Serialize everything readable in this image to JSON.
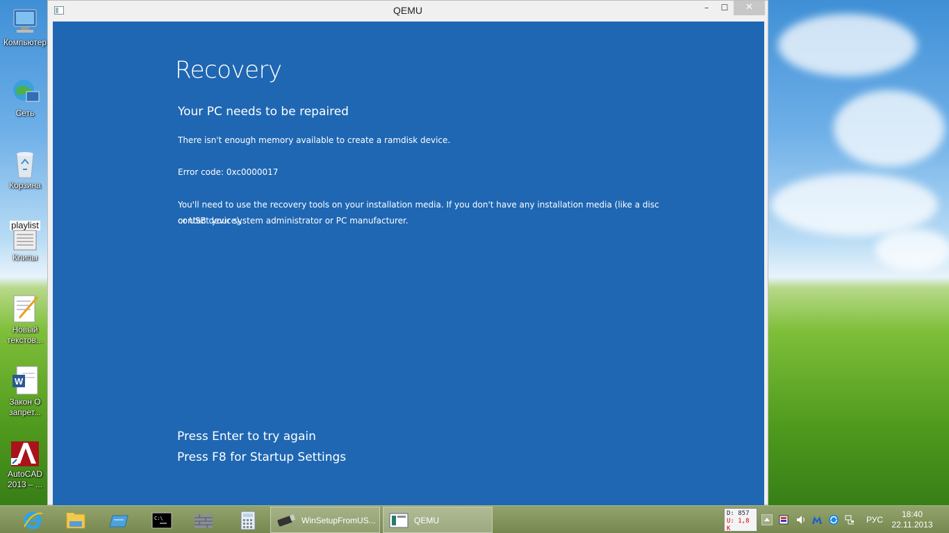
{
  "desktop": {
    "icons": [
      {
        "label": "Компьютер",
        "icon": "computer-icon"
      },
      {
        "label": "Сеть",
        "icon": "network-icon"
      },
      {
        "label": "Корзина",
        "icon": "recycle-bin-icon"
      },
      {
        "label": "Клипы",
        "icon": "playlist-icon",
        "overlay_text": "playlist"
      },
      {
        "label": "Новый текстов...",
        "icon": "text-document-icon"
      },
      {
        "label": "Закон О запрет...",
        "icon": "word-document-icon"
      },
      {
        "label": "AutoCAD 2013 – ...",
        "icon": "autocad-icon"
      }
    ]
  },
  "window": {
    "title": "QEMU",
    "controls": {
      "minimize": "–",
      "maximize": "☐",
      "close": "✕"
    }
  },
  "recovery": {
    "title": "Recovery",
    "subtitle": "Your PC needs to be repaired",
    "message": "There isn't enough memory available to create a ramdisk device.",
    "error_code": "Error code: 0xc0000017",
    "advice_line1": "You'll need to use the recovery tools on your installation media. If you don't have any installation media (like a disc or USB device),",
    "advice_line2": "contact your system administrator or PC manufacturer.",
    "option_enter": "Press Enter to try again",
    "option_f8": "Press F8 for Startup Settings",
    "background_color": "#1f67b3"
  },
  "taskbar": {
    "pinned": [
      {
        "name": "internet-explorer-icon"
      },
      {
        "name": "file-explorer-icon"
      },
      {
        "name": "app-window-icon"
      },
      {
        "name": "command-prompt-icon"
      },
      {
        "name": "firewall-icon"
      },
      {
        "name": "calculator-icon"
      }
    ],
    "tasks": [
      {
        "label": "WinSetupFromUS...",
        "icon": "usb-drive-icon"
      },
      {
        "label": "QEMU",
        "icon": "qemu-icon"
      }
    ],
    "net_monitor": {
      "down": "D: 857",
      "up": "U: 1,8 K"
    },
    "language": "РУС",
    "time": "18:40",
    "date": "22.11.2013"
  }
}
